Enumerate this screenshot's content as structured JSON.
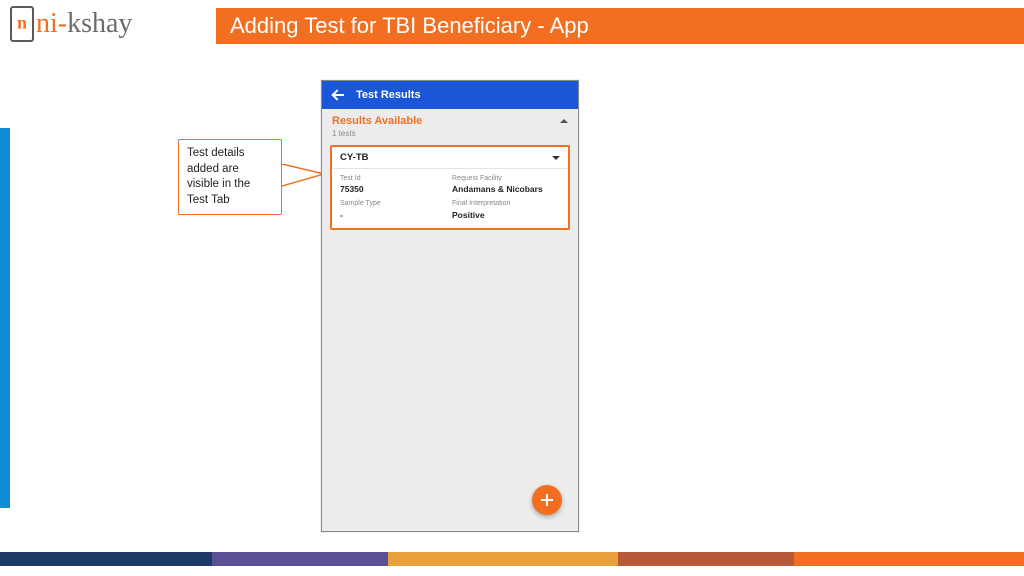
{
  "header": {
    "title": "Adding Test for TBI Beneficiary - App",
    "logo_left": "ni-",
    "logo_right": "kshay"
  },
  "callout": {
    "text": "Test details added are visible in the Test Tab"
  },
  "app": {
    "bar_title": "Test Results",
    "section_title": "Results Available",
    "section_sub": "1 tests",
    "card": {
      "title": "CY-TB",
      "fields": [
        {
          "label": "Test Id",
          "value": "75350"
        },
        {
          "label": "Request Facility",
          "value": "Andamans & Nicobars"
        },
        {
          "label": "Sample Type",
          "value": "-"
        },
        {
          "label": "Final Interpretation",
          "value": "Positive"
        }
      ]
    }
  }
}
